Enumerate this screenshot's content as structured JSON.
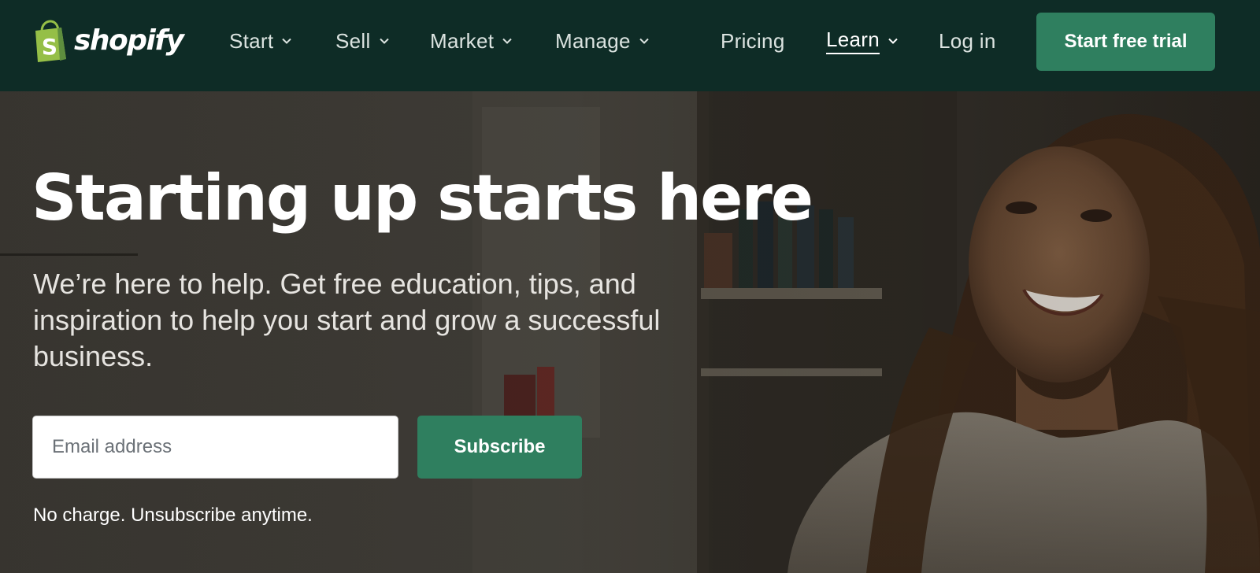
{
  "nav": {
    "logo_text": "shopify",
    "menu": [
      {
        "label": "Start",
        "dropdown": true
      },
      {
        "label": "Sell",
        "dropdown": true
      },
      {
        "label": "Market",
        "dropdown": true
      },
      {
        "label": "Manage",
        "dropdown": true
      }
    ],
    "pricing_label": "Pricing",
    "learn_label": "Learn",
    "login_label": "Log in",
    "cta_label": "Start free trial"
  },
  "hero": {
    "headline": "Starting up starts here",
    "subcopy": "We’re here to help. Get free education, tips, and inspiration to help you start and grow a successful business.",
    "email_placeholder": "Email address",
    "subscribe_label": "Subscribe",
    "disclaimer": "No charge. Unsubscribe anytime.",
    "image_subject": "smiling woman with curly hair in a cream sweater, shop shelves behind"
  },
  "colors": {
    "nav_bg": "#0e2c26",
    "brand_green": "#2f7f5f",
    "logo_bag_green": "#95bf47",
    "text_white": "#ffffff"
  },
  "icons": [
    "shopify-bag-icon",
    "chevron-down-icon"
  ]
}
